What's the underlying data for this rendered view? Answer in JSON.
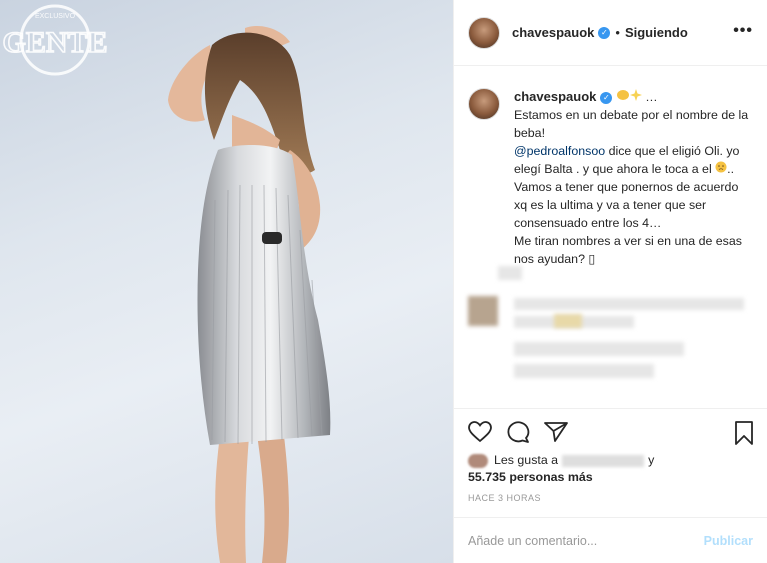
{
  "header": {
    "username": "chavespauok",
    "separator": "•",
    "follow_status": "Siguiendo",
    "more": "•••"
  },
  "caption": {
    "username": "chavespauok",
    "trail": "…",
    "line1": "Estamos en un debate por el nombre de la beba!",
    "mention": "@pedroalfonsoo",
    "line2": " dice que el eligió Oli. yo elegí Balta . y que ahora le toca a el ",
    "line3": ".. Vamos a tener que ponernos de acuerdo xq es la ultima y va a tener que ser consensuado entre los 4…",
    "line4": "Me tiran nombres a ver si en una de esas nos ayudan? ▯"
  },
  "photo": {
    "watermark_top": "EXCLUSIVO",
    "watermark_main": "GENTE"
  },
  "likes": {
    "prefix": "Les gusta a",
    "suffix": "y",
    "count": "55.735 personas más"
  },
  "timestamp": "HACE 3 HORAS",
  "comment": {
    "placeholder": "Añade un comentario...",
    "publish": "Publicar"
  },
  "colors": {
    "accent": "#3897f0",
    "mention": "#003569",
    "publish_disabled": "#b2dffc"
  }
}
